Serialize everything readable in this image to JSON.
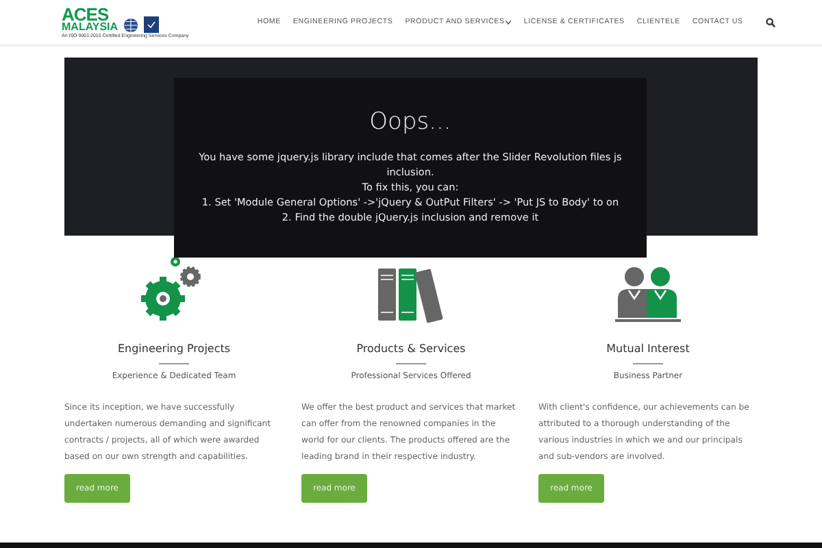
{
  "header": {
    "logo": {
      "line_1": "ACES",
      "line_2": "MALAYSIA",
      "tagline": "An ISO 9001:2015 Certified Engineering Services Company"
    },
    "nav": [
      {
        "label": "HOME",
        "dropdown": false
      },
      {
        "label": "ENGINEERING PROJECTS",
        "dropdown": false
      },
      {
        "label": "PRODUCT AND SERVICES",
        "dropdown": true
      },
      {
        "label": "LICENSE & CERTIFICATES",
        "dropdown": false
      },
      {
        "label": "CLIENTELE",
        "dropdown": false
      },
      {
        "label": "CONTACT US",
        "dropdown": false
      }
    ]
  },
  "slider_error": {
    "title": "Oops...",
    "lines": [
      "You have some jquery.js library include that comes after the Slider Revolution files js inclusion.",
      "To fix this, you can:",
      "1. Set 'Module General Options' ->'jQuery & OutPut Filters' -> 'Put JS to Body' to on",
      "2. Find the double jQuery.js inclusion and remove it"
    ]
  },
  "features": [
    {
      "kind": "gears",
      "title": "Engineering Projects",
      "subtitle": "Experience & Dedicated Team",
      "text": "Since its inception, we have successfully undertaken numerous demanding and significant contracts / projects, all of which were awarded based on our own strength and capabilities.",
      "button": "read more"
    },
    {
      "kind": "books",
      "title": "Products & Services",
      "subtitle": "Professional Services Offered",
      "text": "We offer the best product and services that market can offer from the renowned companies in the world for our clients. The products offered are the leading brand in their respective industry.",
      "button": "read more"
    },
    {
      "kind": "people",
      "title": "Mutual Interest",
      "subtitle": "Business Partner",
      "text": "With client's confidence, our achievements can be attributed to a thorough understanding of the various industries in which we and our principals and sub-vendors are involved.",
      "button": "read more"
    }
  ]
}
